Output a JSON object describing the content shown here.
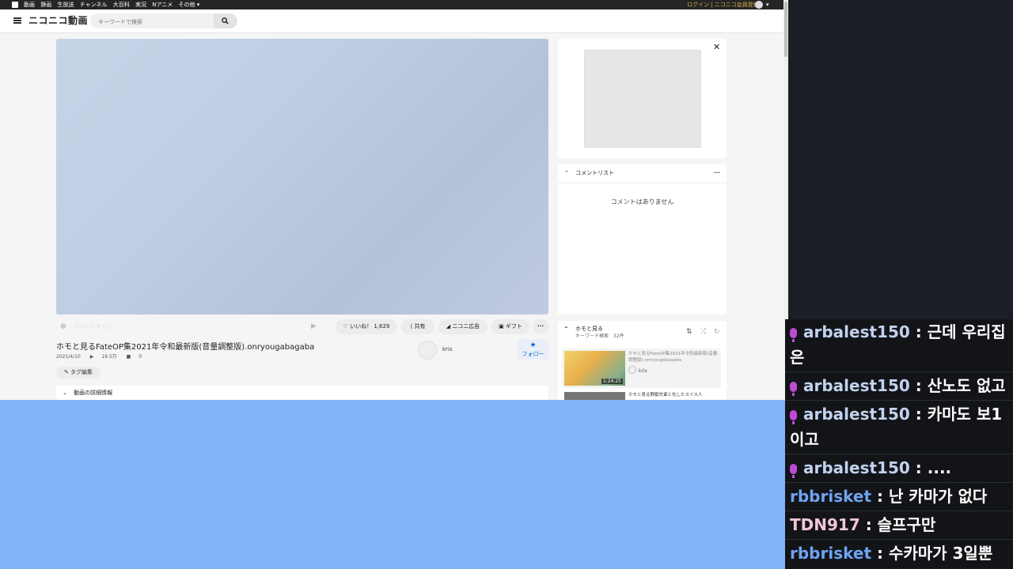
{
  "topbar": {
    "links": [
      "動画",
      "静画",
      "生放送",
      "チャンネル",
      "大百科",
      "実況",
      "Nアニメ",
      "その他 ▾"
    ],
    "login": "ログイン | ニコニコ会員登録"
  },
  "header": {
    "logo": "ニコニコ動画",
    "search_placeholder": "キーワードで検索"
  },
  "player": {
    "comment_placeholder": "コメントを入力",
    "like_label": "いいね！ 1,629",
    "share_label": "共有",
    "ad_label": "ニコニ広告",
    "gift_label": "ギフト",
    "more_label": "···"
  },
  "video": {
    "title": "ホモと見るFateOP集2021年令和最新版(音量調整版).onryougabagaba",
    "date": "2021/4/10",
    "views": "19.5万",
    "comments": "0",
    "tag_edit": "タグ編集",
    "uploader": "kris",
    "follow": "フォロー",
    "details": "動画の詳細情報"
  },
  "sidebar": {
    "comment_list_title": "コメントリスト",
    "no_comments": "コメントはありません",
    "playlist_title": "ホモと見る",
    "playlist_sub": "キーワード検索　32件",
    "item1_title": "ホモと見るFateOP集2021年令和最新版(音量調整版).onryougabagaba",
    "item1_owner": "kris",
    "item1_duration": "1:24:25",
    "item2_title": "ホモと見る野獣先輩と化したスイス人"
  },
  "chat": [
    {
      "user": "arbalest150",
      "text": ": 근데 우리집은",
      "color": "#c2d2ee",
      "mic": true
    },
    {
      "user": "arbalest150",
      "text": ": 산노도 없고",
      "color": "#c2d2ee",
      "mic": true
    },
    {
      "user": "arbalest150",
      "text": ": 카마도 보1이고",
      "color": "#c2d2ee",
      "mic": true
    },
    {
      "user": "arbalest150",
      "text": ": ....",
      "color": "#c2d2ee",
      "mic": true
    },
    {
      "user": "rbbrisket",
      "text": ": 난 카마가 없다",
      "color": "#6fa3ef",
      "mic": false
    },
    {
      "user": "TDN917",
      "text": ": 슬프구만",
      "color": "#f2c6d6",
      "mic": false
    },
    {
      "user": "rbbrisket",
      "text": ": 수카마가 3일뿐",
      "color": "#6fa3ef",
      "mic": false
    }
  ]
}
